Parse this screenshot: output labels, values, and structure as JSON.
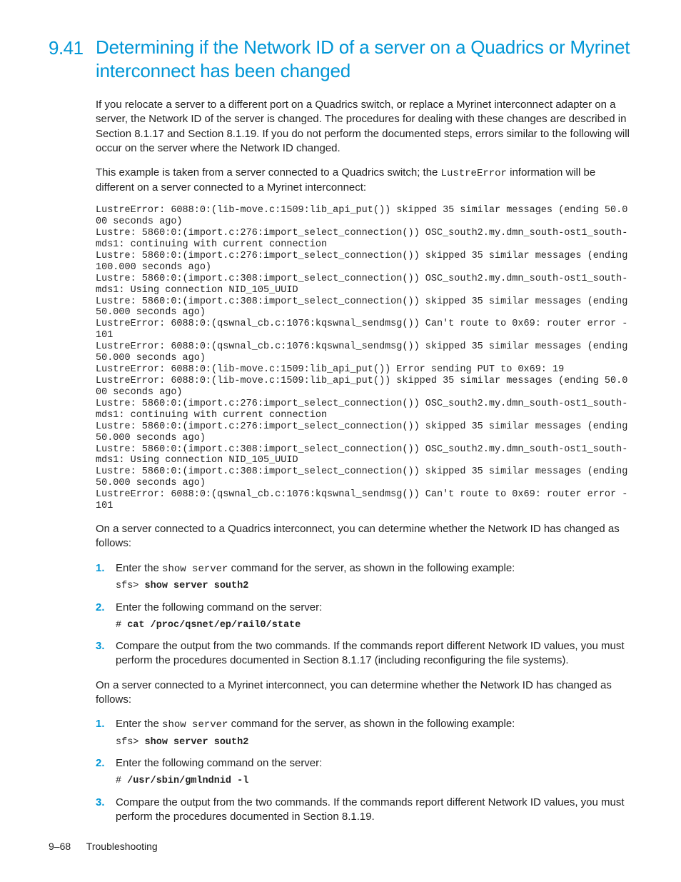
{
  "section": {
    "number": "9.41",
    "title": "Determining if the Network ID of a server on a Quadrics or Myrinet interconnect has been changed"
  },
  "para1": "If you relocate a server to a different port on a Quadrics switch, or replace a Myrinet interconnect adapter on a server, the Network ID of the server is changed. The procedures for dealing with these changes are described in Section 8.1.17 and Section 8.1.19. If you do not perform the documented steps, errors similar to the following will occur on the server where the Network ID changed.",
  "para2_pre": "This example is taken from a server connected to a Quadrics switch; the ",
  "para2_code": "LustreError",
  "para2_post": " information will be different on a server connected to a Myrinet interconnect:",
  "codeblock": "LustreError: 6088:0:(lib-move.c:1509:lib_api_put()) skipped 35 similar messages (ending 50.000 seconds ago)\nLustre: 5860:0:(import.c:276:import_select_connection()) OSC_south2.my.dmn_south-ost1_south-mds1: continuing with current connection\nLustre: 5860:0:(import.c:276:import_select_connection()) skipped 35 similar messages (ending 100.000 seconds ago)\nLustre: 5860:0:(import.c:308:import_select_connection()) OSC_south2.my.dmn_south-ost1_south-mds1: Using connection NID_105_UUID\nLustre: 5860:0:(import.c:308:import_select_connection()) skipped 35 similar messages (ending 50.000 seconds ago)\nLustreError: 6088:0:(qswnal_cb.c:1076:kqswnal_sendmsg()) Can't route to 0x69: router error -101\nLustreError: 6088:0:(qswnal_cb.c:1076:kqswnal_sendmsg()) skipped 35 similar messages (ending 50.000 seconds ago)\nLustreError: 6088:0:(lib-move.c:1509:lib_api_put()) Error sending PUT to 0x69: 19\nLustreError: 6088:0:(lib-move.c:1509:lib_api_put()) skipped 35 similar messages (ending 50.000 seconds ago)\nLustre: 5860:0:(import.c:276:import_select_connection()) OSC_south2.my.dmn_south-ost1_south-mds1: continuing with current connection\nLustre: 5860:0:(import.c:276:import_select_connection()) skipped 35 similar messages (ending 50.000 seconds ago)\nLustre: 5860:0:(import.c:308:import_select_connection()) OSC_south2.my.dmn_south-ost1_south-mds1: Using connection NID_105_UUID\nLustre: 5860:0:(import.c:308:import_select_connection()) skipped 35 similar messages (ending 50.000 seconds ago)\nLustreError: 6088:0:(qswnal_cb.c:1076:kqswnal_sendmsg()) Can't route to 0x69: router error -101",
  "para3": "On a server connected to a Quadrics interconnect, you can determine whether the Network ID has changed as follows:",
  "quadrics": {
    "step1_pre": "Enter the ",
    "step1_code": "show server",
    "step1_post": " command for the server, as shown in the following example:",
    "step1_prompt": "sfs> ",
    "step1_cmd": "show server south2",
    "step2_text": "Enter the following command on the server:",
    "step2_prompt": "# ",
    "step2_cmd": "cat /proc/qsnet/ep/rail0/state",
    "step3_text": "Compare the output from the two commands. If the commands report different Network ID values, you must perform the procedures documented in Section 8.1.17 (including reconfiguring the file systems)."
  },
  "para4": "On a server connected to a Myrinet interconnect, you can determine whether the Network ID has changed as follows:",
  "myrinet": {
    "step1_pre": "Enter the ",
    "step1_code": "show server",
    "step1_post": " command for the server, as shown in the following example:",
    "step1_prompt": "sfs> ",
    "step1_cmd": "show server south2",
    "step2_text": "Enter the following command on the server:",
    "step2_prompt": "# ",
    "step2_cmd": "/usr/sbin/gmlndnid -l",
    "step3_text": "Compare the output from the two commands. If the commands report different Network ID values, you must perform the procedures documented in Section 8.1.19."
  },
  "footer": {
    "page": "9–68",
    "section": "Troubleshooting"
  }
}
